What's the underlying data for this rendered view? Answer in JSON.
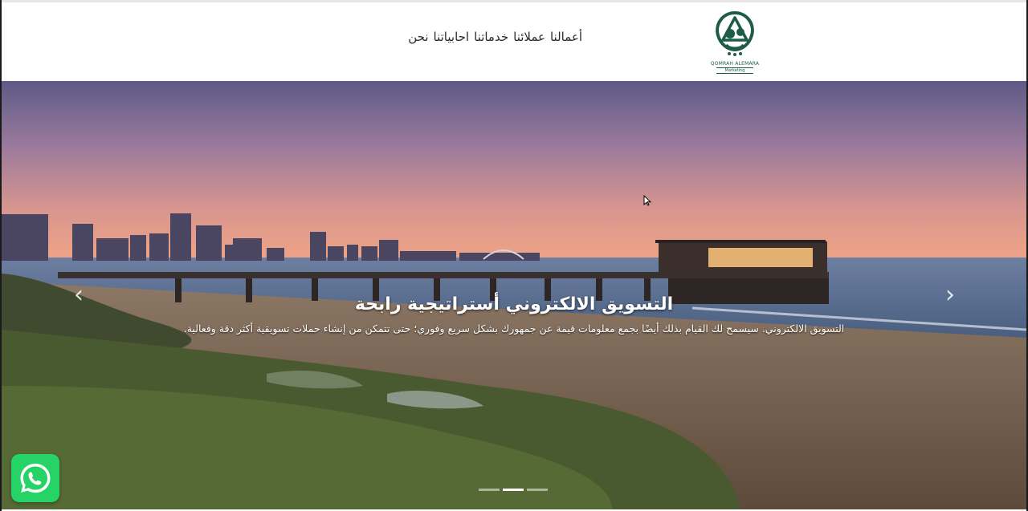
{
  "nav": {
    "items": [
      "نحن",
      "احابياتنا",
      "خدماتنا",
      "عملائنا",
      "أعمالنا"
    ]
  },
  "logo": {
    "brand_text": "QOMRAH ALEMARA",
    "tagline": "Marketing",
    "icon": "qomrah-logo-icon",
    "color": "#1f5c46"
  },
  "hero": {
    "title": "التسويق الالكتروني أستراتيجية رابحة",
    "description": "التسويق الالكتروني. سيسمح لك القيام بذلك أيضًا بجمع معلومات قيمة عن جمهورك بشكل سريع وفوري؛ حتى تتمكن من إنشاء حملات تسويقية أكثر دقة وفعالية.",
    "prev_icon": "chevron-left-icon",
    "next_icon": "chevron-right-icon",
    "prev_label": "‹",
    "next_label": "›",
    "slide_count": 3,
    "active_slide": 2
  },
  "whatsapp": {
    "icon": "whatsapp-icon",
    "color": "#25d366"
  }
}
